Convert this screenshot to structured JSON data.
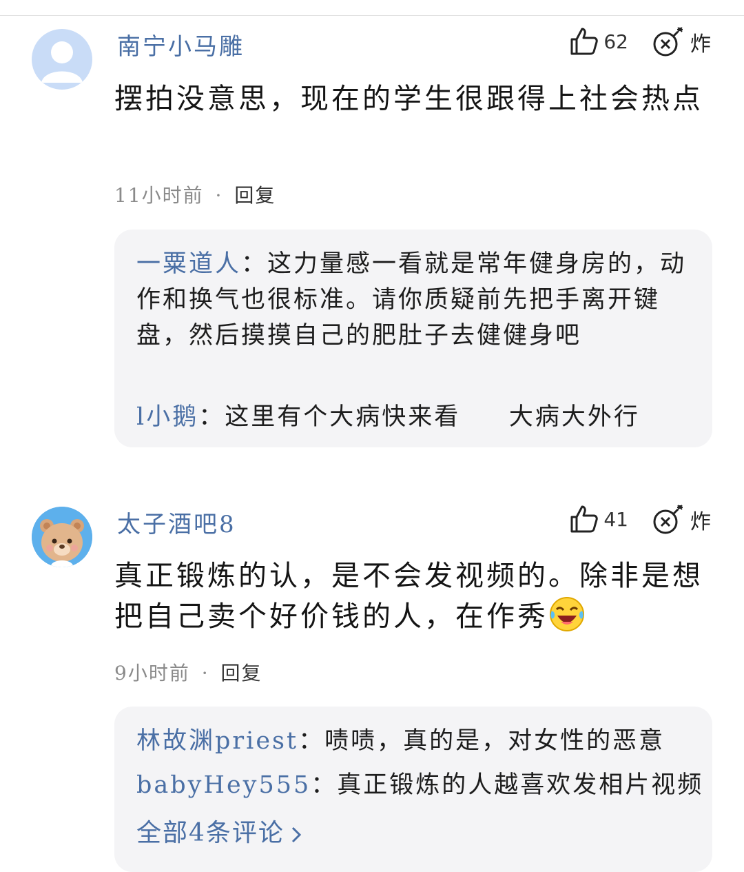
{
  "comments": [
    {
      "username": "南宁小马雕",
      "likes": "62",
      "bomb_label": "炸",
      "text": "摆拍没意思，现在的学生很跟得上社会热点",
      "time": "11小时前",
      "separator": "·",
      "reply_label": "回复",
      "replies": [
        {
          "author": "一粟道人",
          "sep": "：",
          "text": "这力量感一看就是常年健身房的，动作和换气也很标准。请你质疑前先把手离开键盘，然后摸摸自己的肥肚子去健健身吧"
        },
        {
          "author": "l小鹅",
          "sep": "：",
          "text": "这里有个大病快来看     大病大外行"
        }
      ]
    },
    {
      "username": "太子酒吧8",
      "likes": "41",
      "bomb_label": "炸",
      "text": "真正锻炼的认，是不会发视频的。除非是想把自己卖个好价钱的人，在作秀",
      "emoji": "laughing-crying-emoji",
      "time": "9小时前",
      "separator": "·",
      "reply_label": "回复",
      "replies": [
        {
          "author": "林故渊priest",
          "sep": "：",
          "text": "啧啧，真的是，对女性的恶意"
        },
        {
          "author": "babyHey555",
          "sep": "：",
          "text": "真正锻炼的人越喜欢发相片视频"
        }
      ],
      "more_label": "全部4条评论"
    }
  ],
  "colors": {
    "username": "#4a6fa5",
    "reply_bg": "#f4f4f6",
    "meta": "#8a8a8a"
  }
}
